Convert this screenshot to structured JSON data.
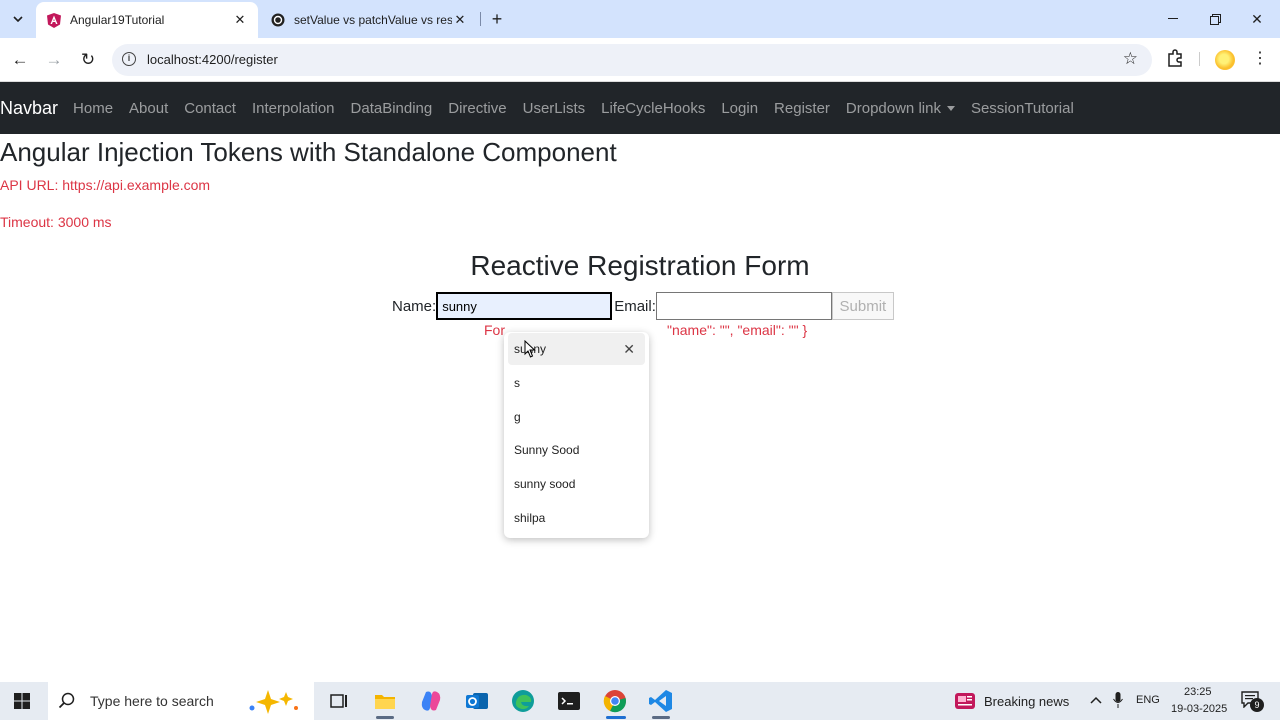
{
  "browser": {
    "tabs": [
      {
        "title": "Angular19Tutorial",
        "active": true
      },
      {
        "title": "setValue vs patchValue vs reset",
        "active": false
      }
    ],
    "url": "localhost:4200/register"
  },
  "navbar": {
    "brand": "Navbar",
    "links": [
      "Home",
      "About",
      "Contact",
      "Interpolation",
      "DataBinding",
      "Directive",
      "UserLists",
      "LifeCycleHooks",
      "Login",
      "Register"
    ],
    "dropdown": "Dropdown link",
    "last_link": "SessionTutorial"
  },
  "page": {
    "heading": "Angular Injection Tokens with Standalone Component",
    "api_url": "API URL: https://api.example.com",
    "timeout": "Timeout: 3000 ms",
    "form_title": "Reactive Registration Form",
    "name_label": "Name:",
    "name_value": "sunny",
    "email_label": "Email:",
    "email_value": "",
    "submit_label": "Submit",
    "status_prefix": "For",
    "status_suffix": "\"name\": \"\", \"email\": \"\" }"
  },
  "autofill": {
    "items": [
      "sunny",
      "s",
      "g",
      "Sunny Sood",
      "sunny sood",
      "shilpa"
    ],
    "remove_icon": "close-icon"
  },
  "taskbar": {
    "search_placeholder": "Type here to search",
    "news": "Breaking news",
    "language": "ENG",
    "time": "23:25",
    "date": "19-03-2025",
    "notification_count": "9"
  }
}
